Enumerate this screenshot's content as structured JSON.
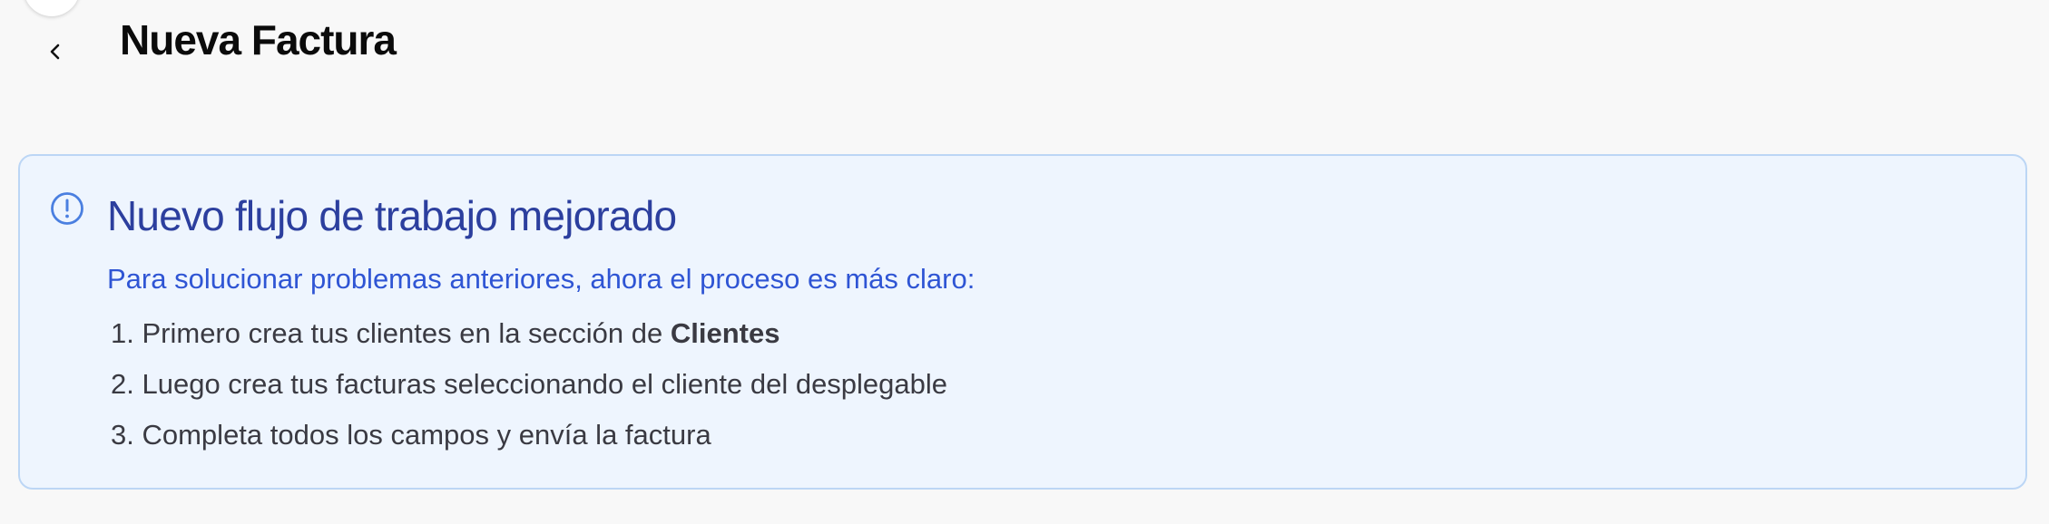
{
  "header": {
    "title": "Nueva Factura",
    "back_icon": "chevron-left-icon"
  },
  "notice": {
    "icon": "alert-circle-icon",
    "title": "Nuevo flujo de trabajo mejorado",
    "subtitle": "Para solucionar problemas anteriores, ahora el proceso es más claro:",
    "steps": [
      {
        "number": "1.",
        "text": "Primero crea tus clientes en la sección de ",
        "bold": "Clientes"
      },
      {
        "number": "2.",
        "text": "Luego crea tus facturas seleccionando el cliente del desplegable"
      },
      {
        "number": "3.",
        "text": "Completa todos los campos y envía la factura"
      }
    ],
    "colors": {
      "background": "#eef5fe",
      "border": "#bcd6f5",
      "title": "#2c3f9e",
      "subtitle": "#2f55d4",
      "icon": "#4a7fe0"
    }
  }
}
